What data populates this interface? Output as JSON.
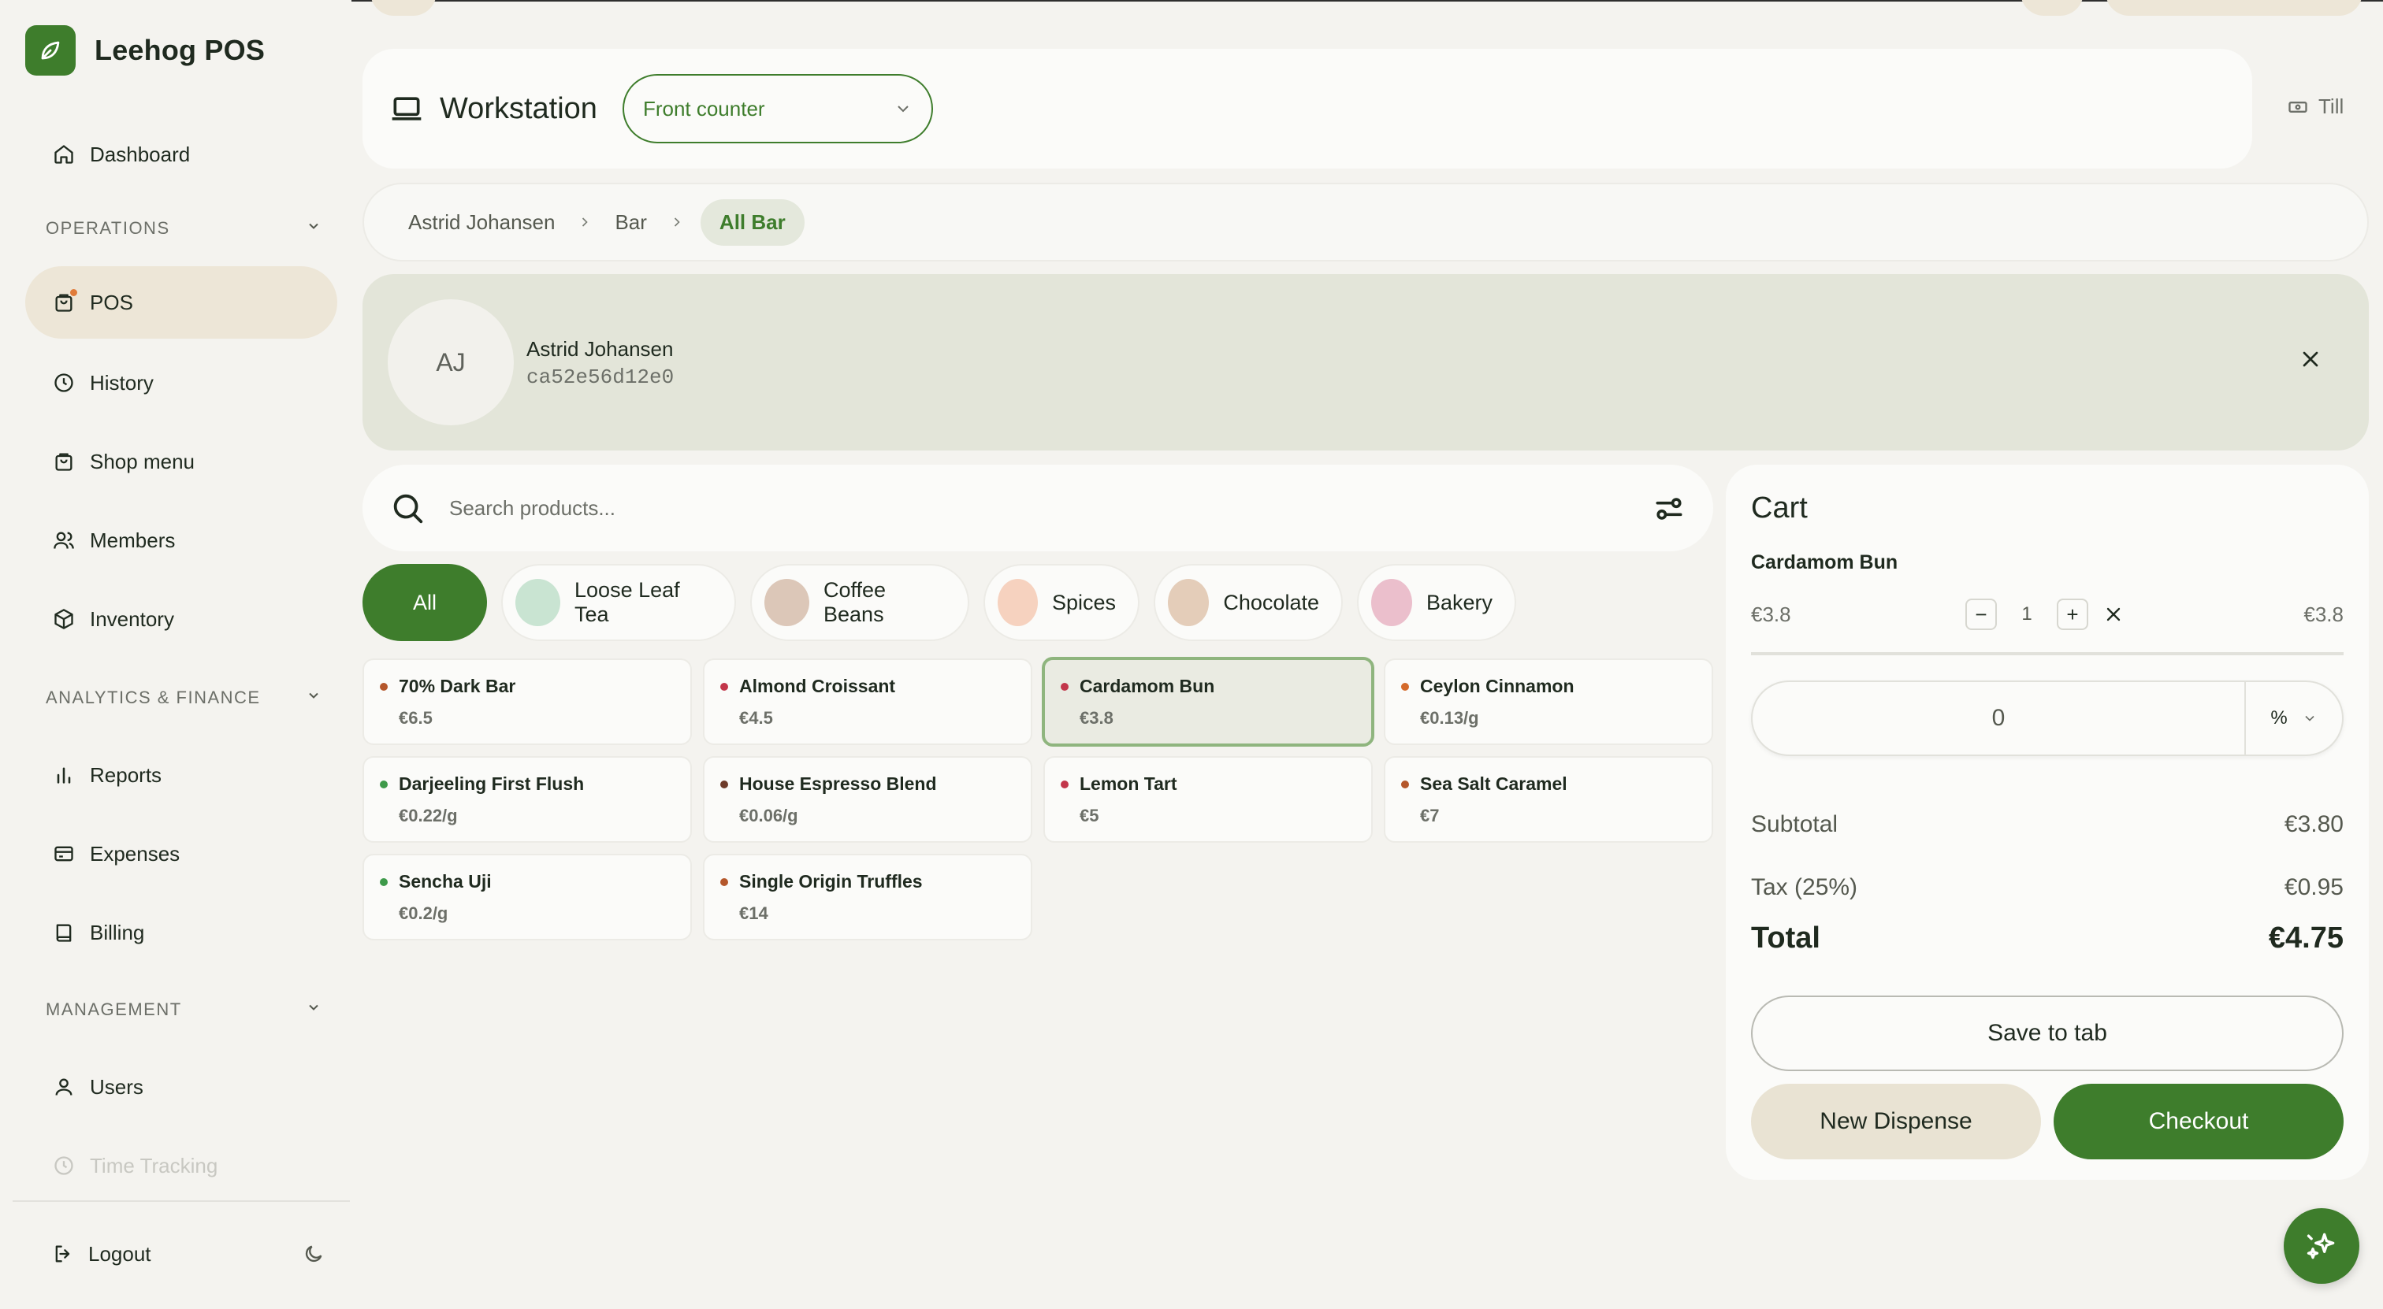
{
  "app": {
    "name": "Leehog POS"
  },
  "sidebar": {
    "dashboard": "Dashboard",
    "sections": {
      "operations": "OPERATIONS",
      "analytics": "ANALYTICS & FINANCE",
      "management": "MANAGEMENT"
    },
    "items": {
      "pos": "POS",
      "history": "History",
      "shop_menu": "Shop menu",
      "members": "Members",
      "inventory": "Inventory",
      "reports": "Reports",
      "expenses": "Expenses",
      "billing": "Billing",
      "users": "Users",
      "time_tracking": "Time Tracking"
    },
    "logout": "Logout"
  },
  "header": {
    "title": "Workstation",
    "workstation_value": "Front counter",
    "till": "Till"
  },
  "breadcrumb": {
    "items": [
      "Astrid Johansen",
      "Bar"
    ],
    "active": "All Bar"
  },
  "member": {
    "initials": "AJ",
    "name": "Astrid Johansen",
    "id": "ca52e56d12e0"
  },
  "search": {
    "placeholder": "Search products..."
  },
  "categories": {
    "all": "All",
    "items": [
      {
        "label": "Loose Leaf Tea",
        "color": "#c9e4d2"
      },
      {
        "label": "Coffee Beans",
        "color": "#dcc7b8"
      },
      {
        "label": "Spices",
        "color": "#f6d2bf"
      },
      {
        "label": "Chocolate",
        "color": "#e4cdb9"
      },
      {
        "label": "Bakery",
        "color": "#ebbfcc"
      }
    ]
  },
  "products": [
    {
      "name": "70% Dark Bar",
      "price": "€6.5",
      "dot": "#b4572b"
    },
    {
      "name": "Almond Croissant",
      "price": "€4.5",
      "dot": "#c2364a"
    },
    {
      "name": "Cardamom Bun",
      "price": "€3.8",
      "dot": "#c2364a"
    },
    {
      "name": "Ceylon Cinnamon",
      "price": "€0.13/g",
      "dot": "#d46a2b"
    },
    {
      "name": "Darjeeling First Flush",
      "price": "€0.22/g",
      "dot": "#3e9a4a"
    },
    {
      "name": "House Espresso Blend",
      "price": "€0.06/g",
      "dot": "#6e3b2a"
    },
    {
      "name": "Lemon Tart",
      "price": "€5",
      "dot": "#c2364a"
    },
    {
      "name": "Sea Salt Caramel",
      "price": "€7",
      "dot": "#b4572b"
    },
    {
      "name": "Sencha Uji",
      "price": "€0.2/g",
      "dot": "#3e9a4a"
    },
    {
      "name": "Single Origin Truffles",
      "price": "€14",
      "dot": "#b4572b"
    }
  ],
  "cart": {
    "title": "Cart",
    "item_name": "Cardamom Bun",
    "unit_price": "€3.8",
    "quantity": "1",
    "line_total": "€3.8",
    "qty_minus": "−",
    "qty_plus": "+",
    "discount_value": "0",
    "discount_unit": "%",
    "subtotal_label": "Subtotal",
    "subtotal": "€3.80",
    "tax_label": "Tax (25%)",
    "tax": "€0.95",
    "total_label": "Total",
    "total": "€4.75",
    "save_to_tab": "Save to tab",
    "new_dispense": "New Dispense",
    "checkout": "Checkout"
  },
  "colors": {
    "accent": "#3e7d2c",
    "active_nav": "#ede6d7",
    "member_bg": "#e3e5d9"
  }
}
